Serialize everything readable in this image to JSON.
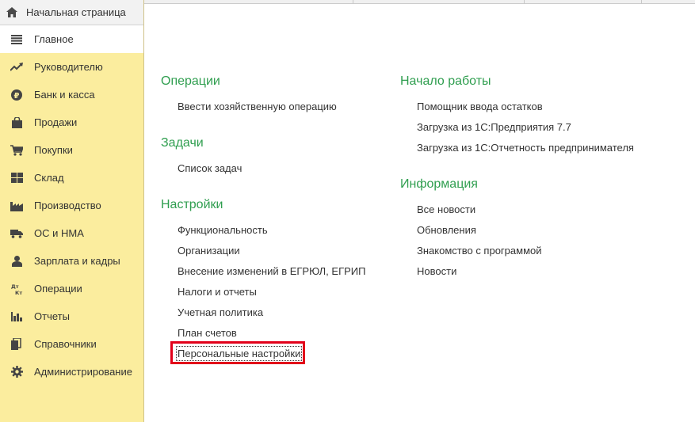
{
  "sidebar": {
    "home_label": "Начальная страница",
    "items": [
      {
        "label": "Главное",
        "icon": "menu-lines-icon"
      },
      {
        "label": "Руководителю",
        "icon": "trend-icon"
      },
      {
        "label": "Банк и касса",
        "icon": "ruble-icon"
      },
      {
        "label": "Продажи",
        "icon": "shopping-bag-icon"
      },
      {
        "label": "Покупки",
        "icon": "cart-icon"
      },
      {
        "label": "Склад",
        "icon": "warehouse-icon"
      },
      {
        "label": "Производство",
        "icon": "factory-icon"
      },
      {
        "label": "ОС и НМА",
        "icon": "truck-icon"
      },
      {
        "label": "Зарплата и кадры",
        "icon": "person-icon"
      },
      {
        "label": "Операции",
        "icon": "debit-credit-icon"
      },
      {
        "label": "Отчеты",
        "icon": "bar-chart-icon"
      },
      {
        "label": "Справочники",
        "icon": "books-icon"
      },
      {
        "label": "Администрирование",
        "icon": "gear-icon"
      }
    ],
    "dtkt_top": "Дт",
    "dtkt_bottom": "Кт"
  },
  "main": {
    "left": {
      "operations": {
        "title": "Операции",
        "links": [
          "Ввести хозяйственную операцию"
        ]
      },
      "tasks": {
        "title": "Задачи",
        "links": [
          "Список задач"
        ]
      },
      "settings": {
        "title": "Настройки",
        "links": [
          "Функциональность",
          "Организации",
          "Внесение изменений в ЕГРЮЛ, ЕГРИП",
          "Налоги и отчеты",
          "Учетная политика",
          "План счетов",
          "Персональные настройки"
        ]
      }
    },
    "right": {
      "start": {
        "title": "Начало работы",
        "links": [
          "Помощник ввода остатков",
          "Загрузка из 1С:Предприятия 7.7",
          "Загрузка из 1С:Отчетность предпринимателя"
        ]
      },
      "info": {
        "title": "Информация",
        "links": [
          "Все новости",
          "Обновления",
          "Знакомство с программой",
          "Новости"
        ]
      }
    }
  },
  "colors": {
    "sidebar_bg": "#fbed9e",
    "section_title": "#2f9e4f",
    "highlight_border": "#e2001a"
  }
}
